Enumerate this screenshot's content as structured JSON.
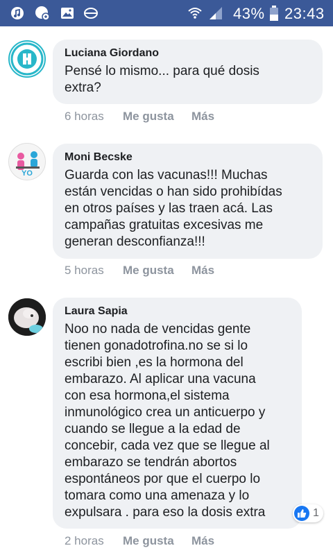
{
  "status_bar": {
    "battery_percent": "43%",
    "time": "23:43",
    "icons": [
      "music-note-icon",
      "notification-icon",
      "gallery-icon",
      "sync-icon",
      "wifi-icon",
      "signal-icon",
      "battery-icon"
    ]
  },
  "colors": {
    "status_bar_bg": "#3b5998",
    "bubble_bg": "#eff1f4",
    "meta_text": "#8d949e",
    "like_blue": "#1877f2"
  },
  "comments": [
    {
      "author": "Luciana Giordano",
      "text": "Pensé lo mismo... para qué dosis\nextra?",
      "time": "6 horas",
      "like_label": "Me gusta",
      "more_label": "Más",
      "avatar_icon": "salvemos-la-familia-logo"
    },
    {
      "author": "Moni Becske",
      "text": "Guarda con las vacunas!!! Muchas\nestán vencidas o han sido prohibídas\nen otros países y las traen acá. Las\ncampañas gratuitas excesivas me\ngeneran desconfianza!!!",
      "time": "5 horas",
      "like_label": "Me gusta",
      "more_label": "Más",
      "avatar_icon": "profile-avatar",
      "avatar_text": "YO"
    },
    {
      "author": "Laura Sapia",
      "text": "Noo no nada de vencidas gente\ntienen gonadotrofina.no se si lo\nescribi bien ,es la hormona del\nembarazo. Al aplicar una vacuna\ncon esa hormona,el sistema\ninmunológico crea un anticuerpo y\ncuando se llegue a la edad de\nconcebir, cada vez que se llegue al\nembarazo se tendrán abortos\nespontáneos por que el cuerpo lo\ntomara como una amenaza y lo\nexpulsara . para eso la dosis extra",
      "time": "2 horas",
      "like_label": "Me gusta",
      "more_label": "Más",
      "avatar_icon": "profile-avatar",
      "reaction_count": "1"
    }
  ]
}
